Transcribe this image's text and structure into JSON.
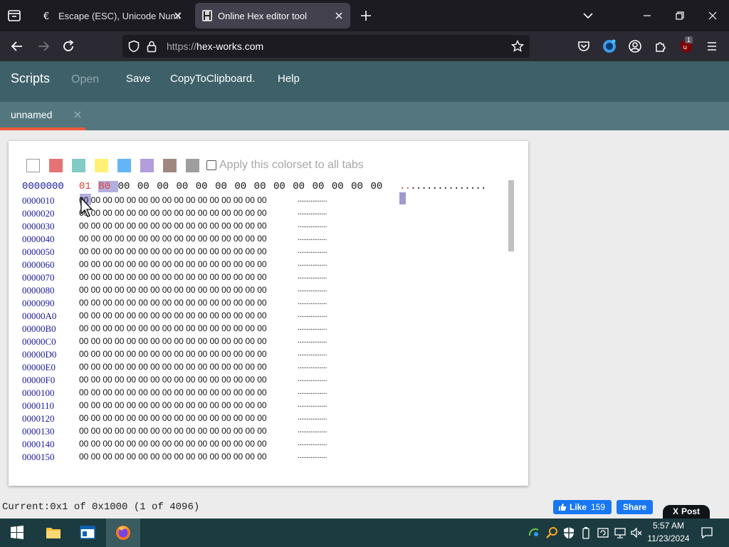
{
  "browser": {
    "tabs": [
      {
        "title": "Escape (ESC), Unicode Number",
        "icon": "unicode-site-icon",
        "active": false
      },
      {
        "title": "Online Hex editor tool",
        "icon": "hexworks-icon",
        "active": true
      }
    ],
    "url": {
      "scheme": "https://",
      "host": "hex-works.com"
    },
    "extension_badge": "1"
  },
  "app": {
    "title": "Scripts",
    "menu": {
      "open": "Open",
      "save": "Save",
      "copy": "CopyToClipboard.",
      "help": "Help"
    },
    "doc_tab": "unnamed"
  },
  "colorset": {
    "swatches": [
      "#ffffff",
      "#e57373",
      "#80cbc4",
      "#fff176",
      "#64b5f6",
      "#b39ddb",
      "#a1887f",
      "#9e9e9e"
    ],
    "apply_label": "Apply this colorset to all tabs"
  },
  "hex": {
    "row0": {
      "offset": "0000000",
      "bytes": [
        "01",
        "B0",
        "00",
        "00",
        "00",
        "00",
        "00",
        "00",
        "00",
        "00",
        "00",
        "00",
        "00",
        "00",
        "00",
        "00"
      ],
      "ascii": "................"
    },
    "rows": [
      {
        "offset": "0000010",
        "bytes": "00 00 00 00 00 00 00 00 00 00 00 00 00 00 00 00",
        "ascii": "................"
      },
      {
        "offset": "0000020",
        "bytes": "00 00 00 00 00 00 00 00 00 00 00 00 00 00 00 00",
        "ascii": "................"
      },
      {
        "offset": "0000030",
        "bytes": "00 00 00 00 00 00 00 00 00 00 00 00 00 00 00 00",
        "ascii": "................"
      },
      {
        "offset": "0000040",
        "bytes": "00 00 00 00 00 00 00 00 00 00 00 00 00 00 00 00",
        "ascii": "................"
      },
      {
        "offset": "0000050",
        "bytes": "00 00 00 00 00 00 00 00 00 00 00 00 00 00 00 00",
        "ascii": "................"
      },
      {
        "offset": "0000060",
        "bytes": "00 00 00 00 00 00 00 00 00 00 00 00 00 00 00 00",
        "ascii": "................"
      },
      {
        "offset": "0000070",
        "bytes": "00 00 00 00 00 00 00 00 00 00 00 00 00 00 00 00",
        "ascii": "................"
      },
      {
        "offset": "0000080",
        "bytes": "00 00 00 00 00 00 00 00 00 00 00 00 00 00 00 00",
        "ascii": "................"
      },
      {
        "offset": "0000090",
        "bytes": "00 00 00 00 00 00 00 00 00 00 00 00 00 00 00 00",
        "ascii": "................"
      },
      {
        "offset": "00000A0",
        "bytes": "00 00 00 00 00 00 00 00 00 00 00 00 00 00 00 00",
        "ascii": "................"
      },
      {
        "offset": "00000B0",
        "bytes": "00 00 00 00 00 00 00 00 00 00 00 00 00 00 00 00",
        "ascii": "................"
      },
      {
        "offset": "00000C0",
        "bytes": "00 00 00 00 00 00 00 00 00 00 00 00 00 00 00 00",
        "ascii": "................"
      },
      {
        "offset": "00000D0",
        "bytes": "00 00 00 00 00 00 00 00 00 00 00 00 00 00 00 00",
        "ascii": "................"
      },
      {
        "offset": "00000E0",
        "bytes": "00 00 00 00 00 00 00 00 00 00 00 00 00 00 00 00",
        "ascii": "................"
      },
      {
        "offset": "00000F0",
        "bytes": "00 00 00 00 00 00 00 00 00 00 00 00 00 00 00 00",
        "ascii": "................"
      },
      {
        "offset": "0000100",
        "bytes": "00 00 00 00 00 00 00 00 00 00 00 00 00 00 00 00",
        "ascii": "................"
      },
      {
        "offset": "0000110",
        "bytes": "00 00 00 00 00 00 00 00 00 00 00 00 00 00 00 00",
        "ascii": "................"
      },
      {
        "offset": "0000120",
        "bytes": "00 00 00 00 00 00 00 00 00 00 00 00 00 00 00 00",
        "ascii": "................"
      },
      {
        "offset": "0000130",
        "bytes": "00 00 00 00 00 00 00 00 00 00 00 00 00 00 00 00",
        "ascii": "................"
      },
      {
        "offset": "0000140",
        "bytes": "00 00 00 00 00 00 00 00 00 00 00 00 00 00 00 00",
        "ascii": "................"
      },
      {
        "offset": "0000150",
        "bytes": "00 00 00 00 00 00 00 00 00 00 00 00 00 00 00 00",
        "ascii": "................"
      }
    ]
  },
  "status": {
    "text": "Current:0x1 of 0x1000 (1 of 4096)",
    "fb_like": "Like",
    "fb_like_count": "159",
    "fb_share": "Share",
    "x_post": "Post"
  },
  "taskbar": {
    "time": "5:57 AM",
    "date": "11/23/2024"
  },
  "colors": {
    "app_bar": "#3e6069",
    "doc_tab_bar": "#54777f",
    "active_tab_underline": "#ef5a3c",
    "offset_text": "#1a1aa0",
    "modified_byte": "#e0402c",
    "selection": "#b2aee0"
  }
}
